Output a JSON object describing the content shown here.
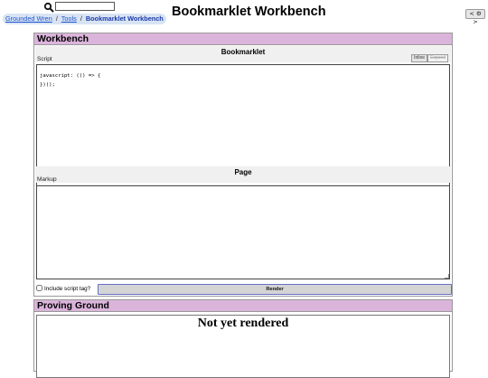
{
  "header": {
    "search": {
      "value": "",
      "placeholder": ""
    },
    "breadcrumb": {
      "items": [
        "Grounded Wren",
        "Tools"
      ],
      "separator": "/",
      "current": "Bookmarklet Workbench"
    },
    "title": "Bookmarklet Workbench",
    "settings_label": "< ⚙ >"
  },
  "workbench": {
    "heading": "Workbench",
    "bookmarklet": {
      "title": "Bookmarklet",
      "script_label": "Script",
      "modes": [
        "Inline",
        "Expand"
      ],
      "active_mode": "Inline",
      "script": "javascript: (() => {\n})();"
    },
    "page": {
      "title": "Page",
      "markup_label": "Markup",
      "markup": ""
    },
    "include_script_label": "Include script tag?",
    "include_script_checked": false,
    "render_label": "Render"
  },
  "proving_ground": {
    "heading": "Proving Ground",
    "status": "Not yet rendered"
  },
  "colors": {
    "panel_header": "#dbb4db",
    "breadcrumb_bg": "#d8e4f4",
    "link": "#2255cc",
    "render_border": "#6470c8"
  }
}
